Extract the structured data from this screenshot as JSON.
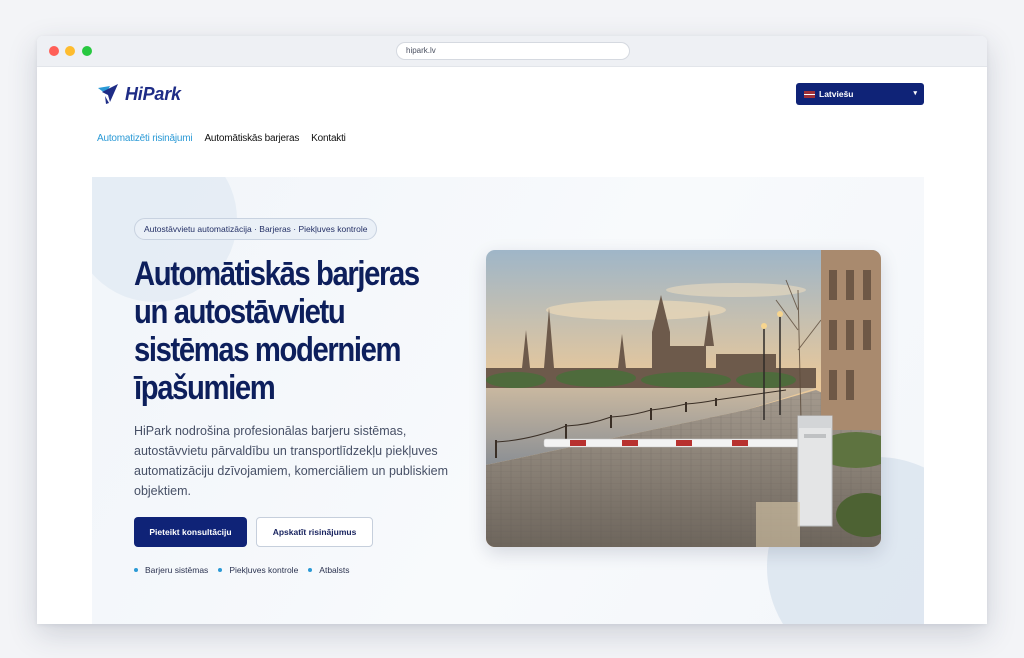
{
  "browser": {
    "url": "hipark.lv"
  },
  "header": {
    "logo_text": "HiPark",
    "language_selector": {
      "selected": "Latviešu",
      "flag": "latvia-flag"
    }
  },
  "nav": {
    "items": [
      {
        "label": "Automatizēti risinājumi",
        "active": true
      },
      {
        "label": "Automātiskās barjeras",
        "active": false
      },
      {
        "label": "Kontakti",
        "active": false
      }
    ]
  },
  "hero": {
    "tag": "Autostāvvietu automatizācija · Barjeras · Piekļuves kontrole",
    "title_lines": [
      "Automātiskās barjeras",
      "un autostāvvietu",
      "sistēmas moderniem",
      "īpašumiem"
    ],
    "lead": "HiPark nodrošina profesionālas barjeru sistēmas, autostāvvietu pārvaldību un transportlīdzekļu piekļuves automatizāciju dzīvojamiem, komerciāliem un publiskiem objektiem.",
    "primary_button": "Pieteikt konsultāciju",
    "secondary_button": "Apskatīt risinājumus",
    "features": [
      "Barjeru sistēmas",
      "Piekļuves kontrole",
      "Atbalsts"
    ],
    "image_alt": "Automatic parking barrier on a cobblestone riverside promenade with the Riga skyline at sunset"
  },
  "colors": {
    "brand_navy": "#0f2377",
    "accent_blue": "#2b9ad6",
    "heading": "#0d1f5c"
  }
}
